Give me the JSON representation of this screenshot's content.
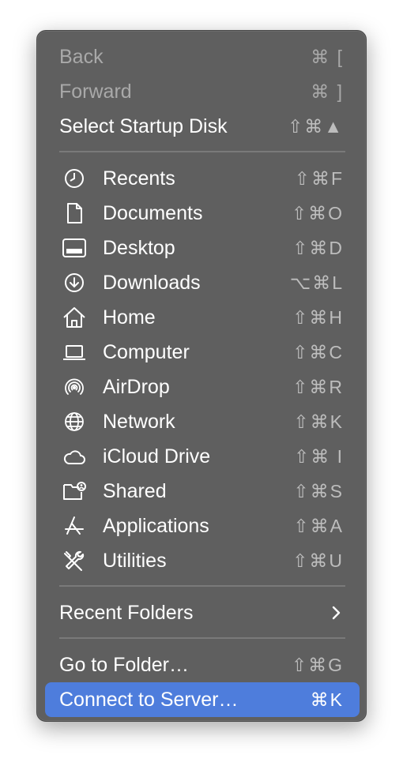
{
  "menu": {
    "nav_items": [
      {
        "label": "Back",
        "shortcut": "⌘ [",
        "enabled": false
      },
      {
        "label": "Forward",
        "shortcut": "⌘ ]",
        "enabled": false
      },
      {
        "label": "Select Startup Disk",
        "shortcut": "⇧⌘▲",
        "enabled": true
      }
    ],
    "places": [
      {
        "label": "Recents",
        "shortcut": "⇧⌘F",
        "icon": "clock-icon"
      },
      {
        "label": "Documents",
        "shortcut": "⇧⌘O",
        "icon": "document-icon"
      },
      {
        "label": "Desktop",
        "shortcut": "⇧⌘D",
        "icon": "desktop-icon"
      },
      {
        "label": "Downloads",
        "shortcut": "⌥⌘L",
        "icon": "download-icon"
      },
      {
        "label": "Home",
        "shortcut": "⇧⌘H",
        "icon": "home-icon"
      },
      {
        "label": "Computer",
        "shortcut": "⇧⌘C",
        "icon": "laptop-icon"
      },
      {
        "label": "AirDrop",
        "shortcut": "⇧⌘R",
        "icon": "airdrop-icon"
      },
      {
        "label": "Network",
        "shortcut": "⇧⌘K",
        "icon": "globe-icon"
      },
      {
        "label": "iCloud Drive",
        "shortcut": "⇧⌘ I",
        "icon": "cloud-icon"
      },
      {
        "label": "Shared",
        "shortcut": "⇧⌘S",
        "icon": "shared-folder-icon"
      },
      {
        "label": "Applications",
        "shortcut": "⇧⌘A",
        "icon": "applications-icon"
      },
      {
        "label": "Utilities",
        "shortcut": "⇧⌘U",
        "icon": "utilities-icon"
      }
    ],
    "recent_folders": {
      "label": "Recent Folders",
      "icon": "chevron-right-icon"
    },
    "go_to_folder": {
      "label": "Go to Folder…",
      "shortcut": "⇧⌘G"
    },
    "connect_to_server": {
      "label": "Connect to Server…",
      "shortcut": "⌘K",
      "selected": true
    }
  },
  "colors": {
    "menu_background": "#5f5f5f",
    "selection": "#4e7ddc",
    "disabled_text": "#a9a9a9",
    "shortcut_text": "#bdbdbd"
  }
}
